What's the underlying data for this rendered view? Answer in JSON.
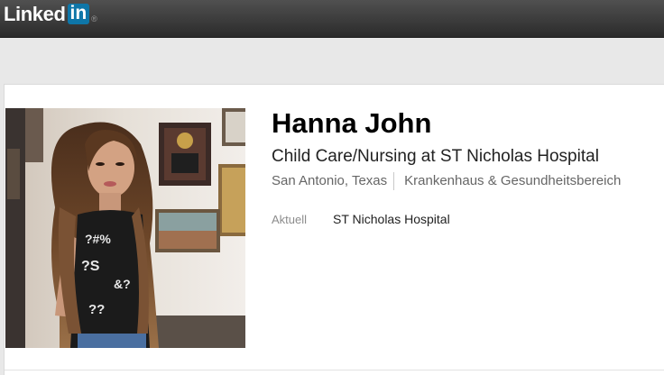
{
  "brand": {
    "logo_text": "Linked",
    "logo_box": "in",
    "registered_mark": "®"
  },
  "profile": {
    "name": "Hanna John",
    "headline": "Child Care/Nursing at ST Nicholas Hospital",
    "location": "San Antonio, Texas",
    "industry": "Krankenhaus & Gesundheitsbereich",
    "current_label": "Aktuell",
    "current_value": "ST Nicholas Hospital"
  },
  "colors": {
    "brand_blue": "#0e76a8",
    "topbar": "#3a3a3a"
  }
}
